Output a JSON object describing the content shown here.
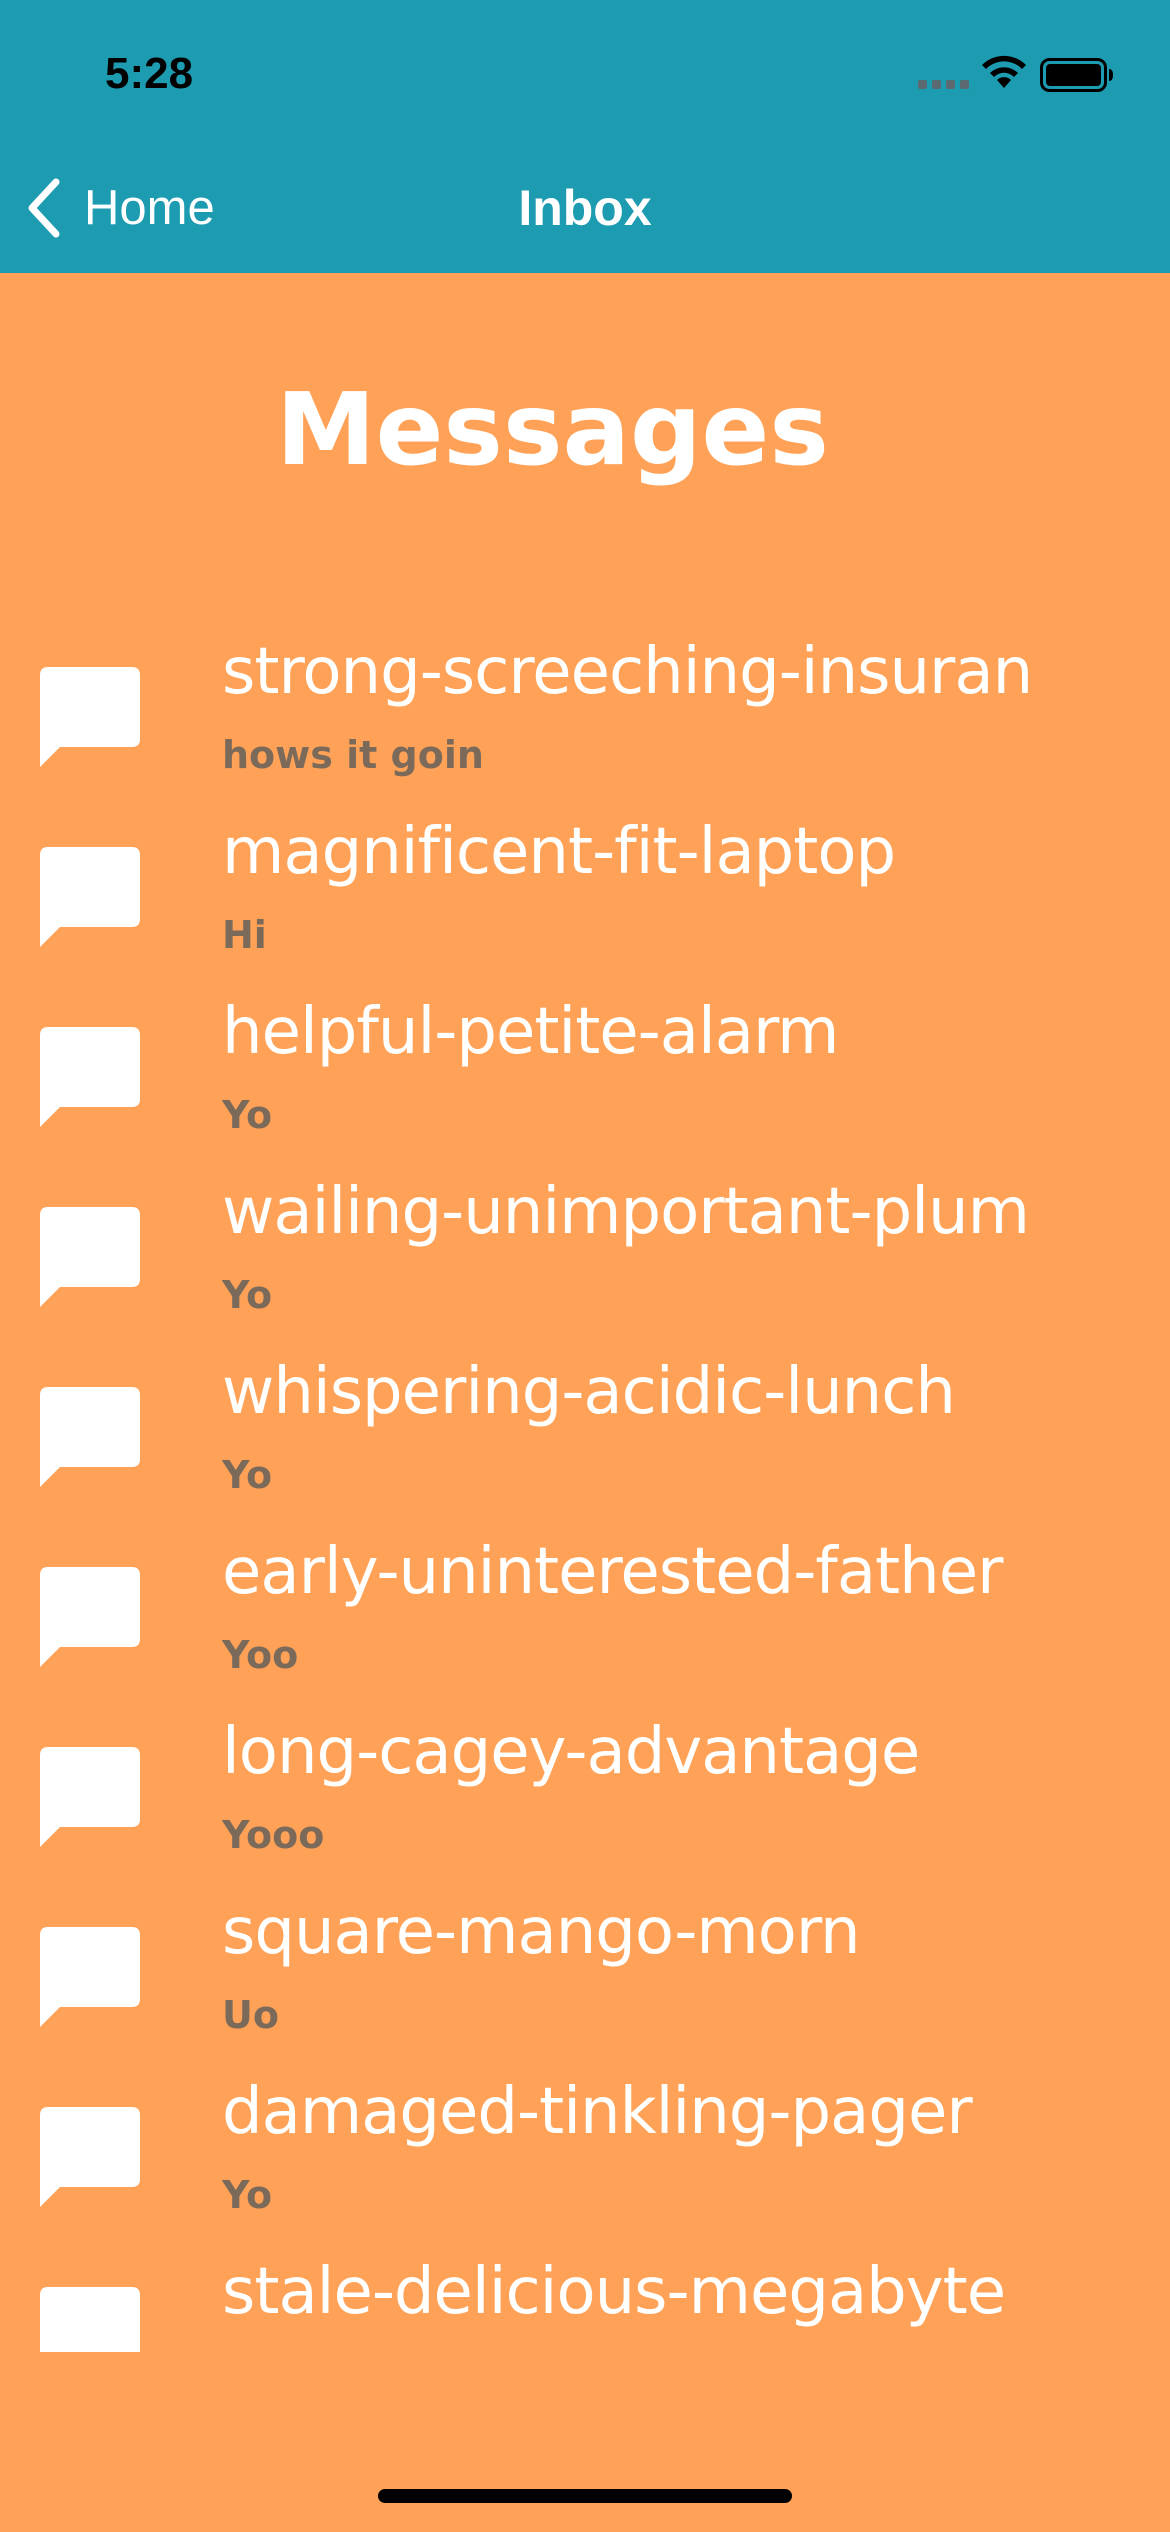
{
  "status_bar": {
    "time": "5:28",
    "icons": [
      "cellular-signal-icon",
      "wifi-icon",
      "battery-icon"
    ]
  },
  "nav": {
    "back_label": "Home",
    "title": "Inbox",
    "bar_color": "#1C9BB1"
  },
  "page": {
    "title": "Messages",
    "background_color": "#FFA257"
  },
  "messages": [
    {
      "name": "strong-screeching-insuran",
      "preview": "hows it goin"
    },
    {
      "name": "magnificent-fit-laptop",
      "preview": "Hi"
    },
    {
      "name": "helpful-petite-alarm",
      "preview": "Yo"
    },
    {
      "name": "wailing-unimportant-plum",
      "preview": "Yo"
    },
    {
      "name": "whispering-acidic-lunch",
      "preview": "Yo"
    },
    {
      "name": "early-uninterested-father",
      "preview": "Yoo"
    },
    {
      "name": "long-cagey-advantage",
      "preview": "Yooo"
    },
    {
      "name": "square-mango-morn",
      "preview": "Uo"
    },
    {
      "name": "damaged-tinkling-pager",
      "preview": "Yo"
    },
    {
      "name": "stale-delicious-megabyte",
      "preview": ""
    }
  ]
}
